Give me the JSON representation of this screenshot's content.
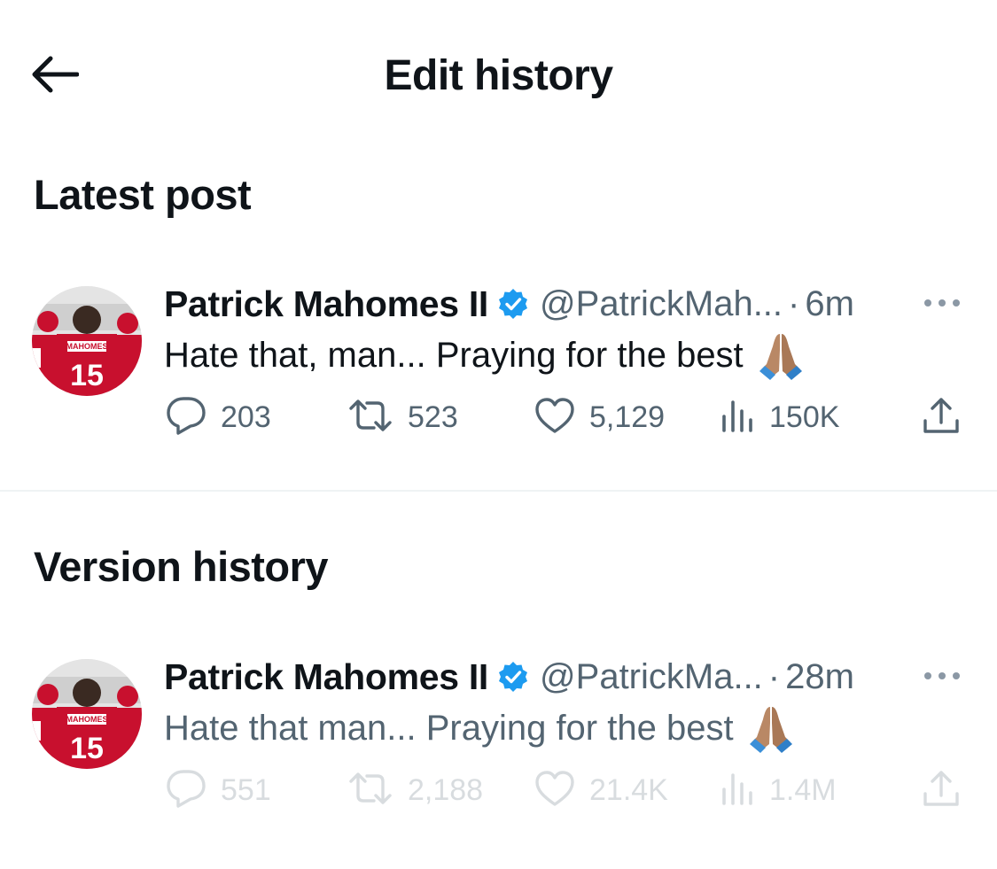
{
  "header": {
    "title": "Edit history"
  },
  "sections": {
    "latest": "Latest post",
    "version": "Version history"
  },
  "latest_post": {
    "author": "Patrick Mahomes II",
    "handle": "@PatrickMah...",
    "separator": "·",
    "time": "6m",
    "text": "Hate that, man... Praying for the best",
    "replies": "203",
    "reposts": "523",
    "likes": "5,129",
    "views": "150K"
  },
  "version_post": {
    "author": "Patrick Mahomes II",
    "handle": "@PatrickMa...",
    "separator": "·",
    "time": "28m",
    "text": "Hate that man... Praying for the best",
    "replies": "551",
    "reposts": "2,188",
    "likes": "21.4K",
    "views": "1.4M"
  },
  "icons": {
    "back": "arrow-left-icon",
    "verified": "verified-badge-icon",
    "more": "more-horizontal-icon",
    "reply": "reply-icon",
    "repost": "repost-icon",
    "like": "heart-icon",
    "views": "views-icon",
    "share": "share-icon",
    "emoji": "praying-hands-emoji"
  },
  "colors": {
    "verified": "#1d9bf0",
    "text": "#0f1419",
    "secondary": "#536471",
    "divider": "#eff3f4"
  }
}
